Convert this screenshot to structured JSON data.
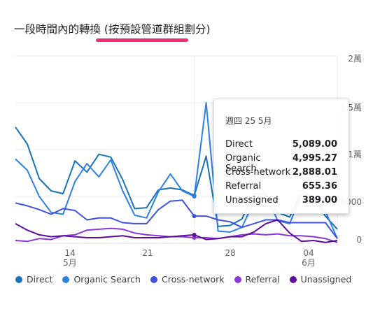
{
  "card": {
    "title": "一段時間內的轉換 (按預設管道群組劃分)",
    "accent_color": "#ee2e75"
  },
  "chart_data": {
    "type": "line",
    "y_tick_labels": [
      "2萬",
      "1.5萬",
      "1萬",
      "5000",
      "0"
    ],
    "ylim": [
      0,
      20000
    ],
    "x_ticks": [
      {
        "day": "14",
        "month": "5月"
      },
      {
        "day": "21",
        "month": ""
      },
      {
        "day": "28",
        "month": ""
      },
      {
        "day": "04",
        "month": "6月"
      }
    ],
    "x": [
      "5/10",
      "5/11",
      "5/12",
      "5/13",
      "5/14",
      "5/15",
      "5/16",
      "5/17",
      "5/18",
      "5/19",
      "5/20",
      "5/21",
      "5/22",
      "5/23",
      "5/24",
      "5/25",
      "5/26",
      "5/27",
      "5/28",
      "5/29",
      "5/30",
      "5/31",
      "6/01",
      "6/02",
      "6/03",
      "6/04",
      "6/05",
      "6/06"
    ],
    "series": [
      {
        "name": "Direct",
        "color": "#1a73b8",
        "values": [
          12400,
          10600,
          6900,
          5600,
          5300,
          8800,
          7600,
          9500,
          9200,
          6800,
          3700,
          3800,
          5700,
          5900,
          5700,
          5100,
          9300,
          1800,
          1900,
          2600,
          5300,
          5200,
          3300,
          2800,
          5600,
          4900,
          2900,
          1500
        ]
      },
      {
        "name": "Organic Search",
        "color": "#2f7fe8",
        "values": [
          9000,
          7800,
          5000,
          3300,
          3100,
          6600,
          8500,
          7100,
          8900,
          5600,
          3000,
          2700,
          5500,
          7400,
          5600,
          5000,
          15000,
          1300,
          1200,
          1700,
          4400,
          5300,
          2400,
          2100,
          5200,
          5000,
          3400,
          500
        ]
      },
      {
        "name": "Cross-network",
        "color": "#3f51e0",
        "values": [
          4300,
          4000,
          3600,
          3100,
          3700,
          3500,
          2500,
          2700,
          2700,
          2200,
          2100,
          2100,
          3600,
          4500,
          4600,
          2900,
          2900,
          2500,
          2300,
          1700,
          2100,
          2500,
          2500,
          2200,
          2200,
          2200,
          2200,
          500
        ]
      },
      {
        "name": "Referral",
        "color": "#8b37d8",
        "values": [
          300,
          200,
          500,
          400,
          800,
          900,
          1400,
          1500,
          1600,
          1500,
          1100,
          900,
          800,
          700,
          700,
          600,
          600,
          500,
          700,
          900,
          1000,
          900,
          1000,
          800,
          800,
          700,
          500,
          100
        ]
      },
      {
        "name": "Unassigned",
        "color": "#5a0e9a",
        "values": [
          2100,
          1400,
          900,
          700,
          800,
          700,
          600,
          600,
          700,
          800,
          600,
          600,
          600,
          700,
          800,
          900,
          400,
          500,
          700,
          700,
          1200,
          2100,
          2500,
          1100,
          200,
          300,
          100,
          300
        ]
      }
    ],
    "highlight_date": "5/25"
  },
  "tooltip": {
    "date": "週四 25 5月",
    "rows": [
      {
        "name": "Direct",
        "value": "5,089.00"
      },
      {
        "name": "Organic Search",
        "value": "4,995.27"
      },
      {
        "name": "Cross-network",
        "value": "2,888.01"
      },
      {
        "name": "Referral",
        "value": "655.36"
      },
      {
        "name": "Unassigned",
        "value": "389.00"
      }
    ]
  },
  "legend": [
    {
      "name": "Direct",
      "color": "#1a73b8"
    },
    {
      "name": "Organic Search",
      "color": "#2f7fe8"
    },
    {
      "name": "Cross-network",
      "color": "#3f51e0"
    },
    {
      "name": "Referral",
      "color": "#8b37d8"
    },
    {
      "name": "Unassigned",
      "color": "#5a0e9a"
    }
  ]
}
